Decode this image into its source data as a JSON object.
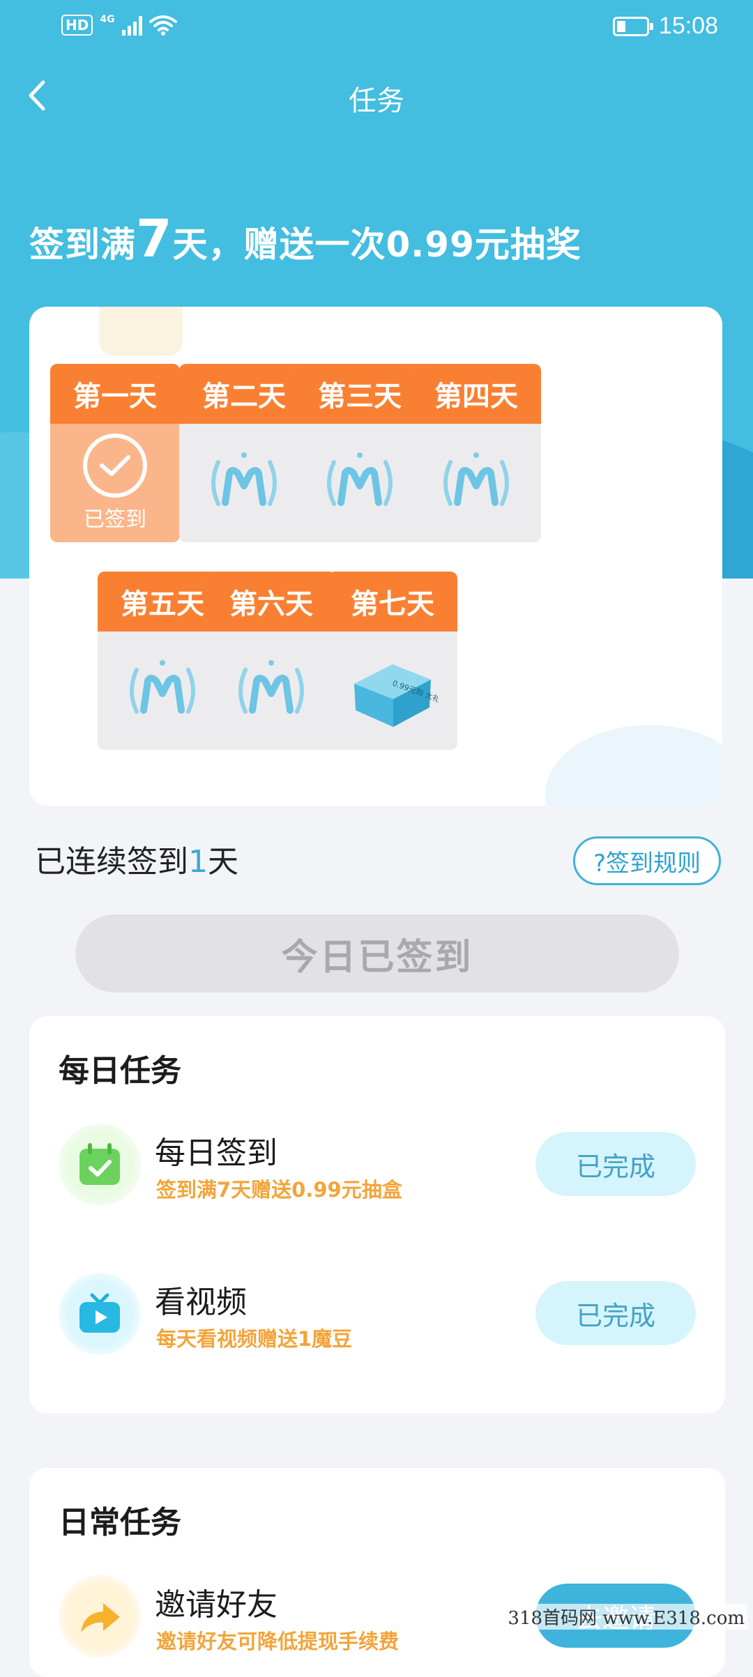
{
  "status_bar": {
    "hd": "HD",
    "network": "4G",
    "time": "15:08"
  },
  "nav": {
    "title": "任务"
  },
  "headline": {
    "prefix": "签到满",
    "days": "7",
    "suffix": "天，赠送一次0.99元抽奖"
  },
  "sign_days": [
    {
      "label": "第一天",
      "status": "已签到",
      "signed": true
    },
    {
      "label": "第二天",
      "signed": false
    },
    {
      "label": "第三天",
      "signed": false
    },
    {
      "label": "第四天",
      "signed": false
    },
    {
      "label": "第五天",
      "signed": false
    },
    {
      "label": "第六天",
      "signed": false
    },
    {
      "label": "第七天",
      "signed": false,
      "gift": true,
      "gift_text": "0.99元购\n大礼包"
    }
  ],
  "streak": {
    "prefix": "已连续签到",
    "count": "1",
    "suffix": "天"
  },
  "rules_button": "?签到规则",
  "signed_button": "今日已签到",
  "daily_tasks": {
    "title": "每日任务",
    "items": [
      {
        "name": "每日签到",
        "desc": "签到满7天赠送0.99元抽盒",
        "button": "已完成",
        "icon": "calendar-check-icon"
      },
      {
        "name": "看视频",
        "desc": "每天看视频赠送1魔豆",
        "button": "已完成",
        "icon": "tv-play-icon"
      }
    ]
  },
  "regular_tasks": {
    "title": "日常任务",
    "items": [
      {
        "name": "邀请好友",
        "desc": "邀请好友可降低提现手续费",
        "button": "去邀请",
        "icon": "share-arrow-icon"
      }
    ]
  },
  "watermark": "318首码网 www.E318.com",
  "colors": {
    "primary": "#43bde0",
    "orange": "#f98032",
    "accent_text": "#f3a43a"
  }
}
